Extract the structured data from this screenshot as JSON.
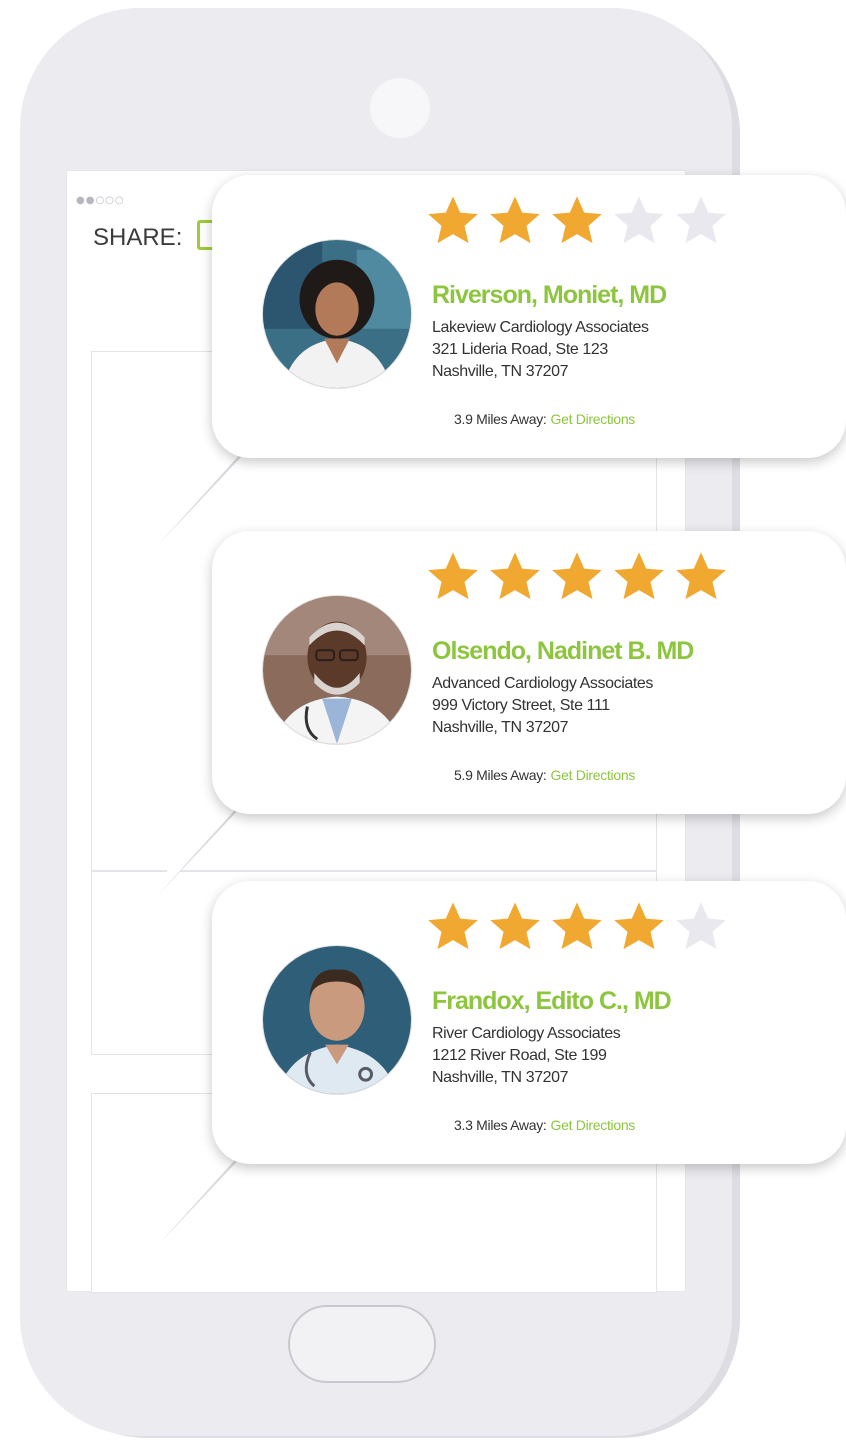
{
  "screen": {
    "share_label": "SHARE:",
    "status_dots": "●●○○○"
  },
  "icons": {
    "share": "phone-outline-icon",
    "star": "star-icon"
  },
  "colors": {
    "accent_green": "#8dc53e",
    "star_filled": "#f0a830",
    "star_empty": "#e9e8ee",
    "phone_body": "#ecebf0"
  },
  "doctors": [
    {
      "name": "Riverson, Moniet, MD",
      "practice": "Lakeview Cardiology Associates",
      "address": "321 Lideria Road, Ste 123",
      "city": "Nashville, TN 37207",
      "distance": "3.9 Miles Away:",
      "directions_label": "Get Directions",
      "rating": 3,
      "rating_max": 5,
      "avatar": "doctor-portrait-woman"
    },
    {
      "name": "Olsendo, Nadinet B. MD",
      "practice": "Advanced Cardiology Associates",
      "address": "999 Victory Street, Ste 111",
      "city": "Nashville, TN 37207",
      "distance": "5.9 Miles Away:",
      "directions_label": "Get Directions",
      "rating": 5,
      "rating_max": 5,
      "avatar": "doctor-portrait-older-man"
    },
    {
      "name": "Frandox, Edito C., MD",
      "practice": "River Cardiology Associates",
      "address": "1212  River Road, Ste 199",
      "city": "Nashville, TN 37207",
      "distance": "3.3 Miles Away:",
      "directions_label": "Get Directions",
      "rating": 4,
      "rating_max": 5,
      "avatar": "doctor-portrait-man"
    }
  ]
}
